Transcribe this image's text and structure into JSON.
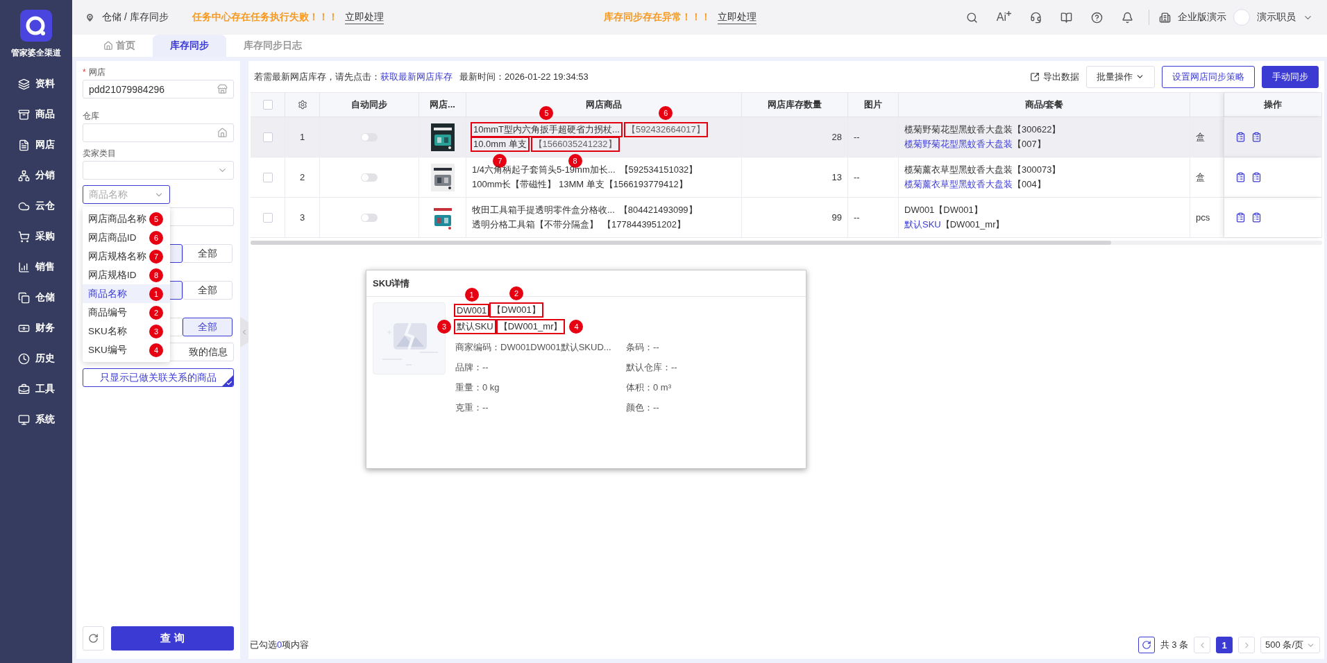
{
  "app": {
    "name": "管家婆全渠道"
  },
  "nav": [
    {
      "label": "资料",
      "kind": "layers"
    },
    {
      "label": "商品",
      "kind": "box"
    },
    {
      "label": "网店",
      "kind": "document"
    },
    {
      "label": "分销",
      "kind": "network"
    },
    {
      "label": "云仓",
      "kind": "cloud"
    },
    {
      "label": "采购",
      "kind": "cart"
    },
    {
      "label": "销售",
      "kind": "chart"
    },
    {
      "label": "仓储",
      "kind": "copy"
    },
    {
      "label": "财务",
      "kind": "money"
    },
    {
      "label": "历史",
      "kind": "clock"
    },
    {
      "label": "工具",
      "kind": "briefcase"
    },
    {
      "label": "系统",
      "kind": "monitor"
    }
  ],
  "topbar": {
    "breadcrumb": {
      "parent": "仓储",
      "separator": "/",
      "current": "库存同步"
    },
    "alerts": [
      {
        "message": "任务中心存在任务执行失败！！！",
        "action": "立即处理"
      },
      {
        "message": "库存同步存在异常！！！",
        "action": "立即处理"
      }
    ],
    "ai": "Ai",
    "company": "企业版演示",
    "user": "演示职员"
  },
  "tabs": [
    {
      "label": "首页",
      "kind": "home",
      "selected": false
    },
    {
      "label": "库存同步",
      "kind": "plain",
      "selected": true
    },
    {
      "label": "库存同步日志",
      "kind": "plain",
      "selected": false
    }
  ],
  "filters": {
    "shop": {
      "label": "网店",
      "required_mark": "*",
      "value": "pdd21079984296"
    },
    "warehouse": {
      "label": "仓库"
    },
    "category": {
      "label": "卖家类目"
    },
    "search_type": {
      "placeholder": "商品名称",
      "open": true,
      "options": [
        {
          "label": "网店商品名称",
          "selected": false,
          "marker": "5"
        },
        {
          "label": "网店商品ID",
          "selected": false,
          "marker": "6"
        },
        {
          "label": "网店规格名称",
          "selected": false,
          "marker": "7"
        },
        {
          "label": "网店规格ID",
          "selected": false,
          "marker": "8"
        },
        {
          "label": "商品名称",
          "selected": true,
          "marker": "1"
        },
        {
          "label": "商品编号",
          "selected": false,
          "marker": "2"
        },
        {
          "label": "SKU名称",
          "selected": false,
          "marker": "3"
        },
        {
          "label": "SKU编号",
          "selected": false,
          "marker": "4"
        }
      ]
    },
    "segments": [
      {
        "options": [
          {
            "selected": true
          },
          {
            "label": "全部",
            "selected": false
          }
        ]
      },
      {
        "options": [
          {
            "selected": true
          },
          {
            "label": "全部",
            "selected": false
          }
        ]
      },
      {
        "options": [
          {
            "selected": false
          },
          {
            "label": "全部",
            "selected": true
          }
        ]
      }
    ],
    "mismatch": {
      "value": "致的信息"
    },
    "linked_only": {
      "label": "只显示已做关联关系的商品",
      "checked": true
    },
    "query": "查 询"
  },
  "toolbar": {
    "hint": "若需最新网店库存，请先点击：",
    "link": "获取最新网店库存",
    "time": "最新时间：2026-01-22 19:34:53",
    "export": "导出数据",
    "batch": "批量操作",
    "strategy": "设置网店同步策略",
    "sync": "手动同步"
  },
  "table": {
    "columns": [
      {
        "kind": "checkbox",
        "checked": false
      },
      {
        "kind": "settings"
      },
      {
        "kind": "text",
        "label": "自动同步"
      },
      {
        "kind": "text",
        "label": "网店..."
      },
      {
        "kind": "text",
        "label": "网店商品"
      },
      {
        "kind": "text",
        "label": "网店库存数量"
      },
      {
        "kind": "text",
        "label": "图片"
      },
      {
        "kind": "text",
        "label": "商品/套餐"
      },
      {
        "kind": "blank"
      },
      {
        "kind": "text",
        "label": "操作"
      }
    ],
    "rows": [
      {
        "selected": false,
        "highlighted": true,
        "index": "1",
        "auto_sync": false,
        "shop_product": [
          {
            "name": "10mmT型内六角扳手超硬省力拐杖...",
            "name_marker": "5",
            "id": "【592432664017】",
            "id_marker": "6"
          },
          {
            "name": "10.0mm 单支",
            "name_marker": "7",
            "id": "【1566035241232】",
            "id_marker": "8"
          }
        ],
        "stock": "28",
        "image": "--",
        "product": [
          {
            "kind": "plain",
            "text": "榄菊野菊花型黑蚊香大盘装【300622】"
          },
          {
            "kind": "link",
            "name": "榄菊野菊花型黑蚊香大盘装",
            "code": "【007】"
          }
        ],
        "unit": "盒"
      },
      {
        "selected": false,
        "highlighted": false,
        "index": "2",
        "auto_sync": false,
        "shop_product": [
          {
            "name": "1/4六角柄起子套筒头5-19mm加长...",
            "id": "【592534151032】"
          },
          {
            "name": "100mm长【带磁性】 13MM 单支【1566193779412】"
          }
        ],
        "stock": "13",
        "image": "--",
        "product": [
          {
            "kind": "plain",
            "text": "榄菊薰衣草型黑蚊香大盘装【300073】"
          },
          {
            "kind": "link",
            "name": "榄菊薰衣草型黑蚊香大盘装",
            "code": "【004】"
          }
        ],
        "unit": "盒"
      },
      {
        "selected": false,
        "highlighted": false,
        "index": "3",
        "auto_sync": false,
        "shop_product": [
          {
            "name": "牧田工具箱手提透明零件盒分格收...",
            "id": "【804421493099】"
          },
          {
            "name": "透明分格工具箱【不带分隔盒】",
            "id": "【1778443951202】"
          }
        ],
        "stock": "99",
        "image": "--",
        "product": [
          {
            "kind": "plain",
            "text": "DW001【DW001】"
          },
          {
            "kind": "link",
            "name": "默认SKU",
            "code": "【DW001_mr】"
          }
        ],
        "unit": "pcs"
      }
    ]
  },
  "sku_popup": {
    "title": "SKU详情",
    "lines": [
      {
        "name": "DW001",
        "name_marker": "1",
        "code": "【DW001】",
        "code_marker": "2"
      },
      {
        "name": "默认SKU",
        "name_marker": "3",
        "code": "【DW001_mr】",
        "code_marker": "4"
      }
    ],
    "fields": [
      "商家编码：DW001DW001默认SKUD...",
      "条码：--",
      "品牌：--",
      "默认仓库：--",
      "重量：0 kg",
      "体积：0 m³",
      "克重：--",
      "颜色：--"
    ]
  },
  "footer": {
    "selection": {
      "prefix": "已勾选",
      "count": "0",
      "suffix": "项内容"
    },
    "total": "共 3 条",
    "pages": [
      {
        "label": "1",
        "selected": true
      }
    ],
    "page_size": "500 条/页"
  }
}
